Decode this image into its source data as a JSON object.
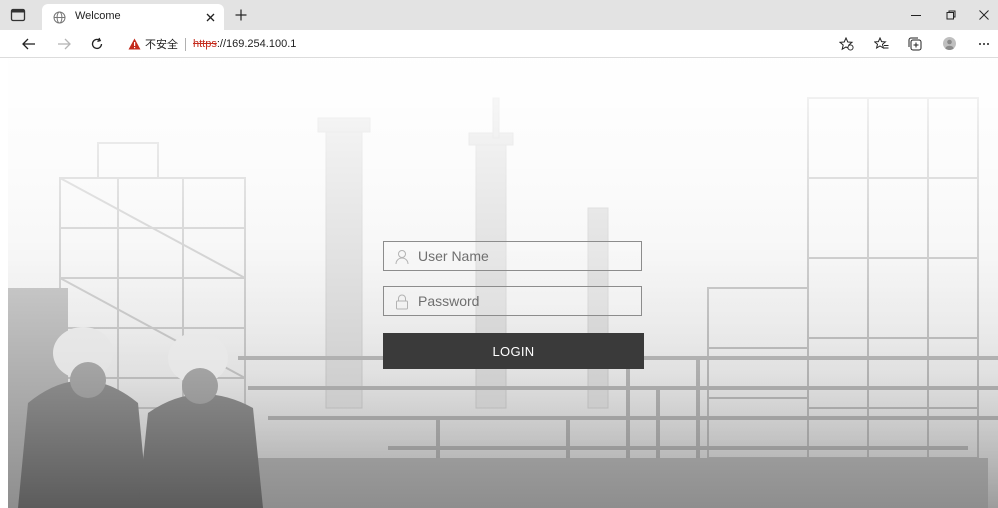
{
  "browser": {
    "tab": {
      "title": "Welcome"
    },
    "security_label": "不安全",
    "url": {
      "scheme": "https",
      "rest": "://169.254.100.1"
    }
  },
  "login": {
    "username_placeholder": "User Name",
    "password_placeholder": "Password",
    "button_label": "LOGIN"
  },
  "colors": {
    "tab_strip": "#e3e3e3",
    "insecure_red": "#c42b1c",
    "login_button": "#3a3a3a"
  },
  "icons": [
    "tab-actions-icon",
    "globe-icon",
    "close-icon",
    "plus-icon",
    "minimize-icon",
    "restore-icon",
    "back-icon",
    "forward-icon",
    "refresh-icon",
    "warning-icon",
    "favorites-add-icon",
    "favorites-icon",
    "collections-icon",
    "profile-icon",
    "more-icon",
    "user-icon",
    "lock-icon"
  ]
}
